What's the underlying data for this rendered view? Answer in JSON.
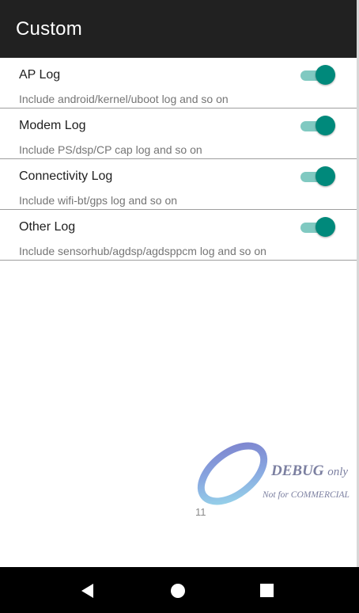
{
  "app_bar": {
    "title": "Custom"
  },
  "log_items": [
    {
      "title": "AP Log",
      "summary": "Include android/kernel/uboot log and so on",
      "enabled": true
    },
    {
      "title": "Modem Log",
      "summary": "Include PS/dsp/CP cap log and so on",
      "enabled": true
    },
    {
      "title": "Connectivity Log",
      "summary": "Include wifi-bt/gps log and so on",
      "enabled": true
    },
    {
      "title": "Other Log",
      "summary": "Include sensorhub/agdsp/agdsppcm log and so on",
      "enabled": true
    }
  ],
  "watermark": {
    "debug_text": "DEBUG",
    "only_text": "only",
    "not_for_text": "Not for COMMERCIAL"
  },
  "page_number": "11",
  "nav_bar": {
    "buttons": [
      "back",
      "home",
      "recents"
    ]
  },
  "colors": {
    "app_bar": "#212121",
    "switch_thumb": "#00897b",
    "switch_track": "#80c9c1",
    "divider": "#9e9e9e",
    "nav_bar": "#000000"
  },
  "icons": {
    "back": "back-triangle-icon",
    "home": "home-circle-icon",
    "recents": "recents-square-icon",
    "watermark_logo": "swirl-logo-icon"
  }
}
